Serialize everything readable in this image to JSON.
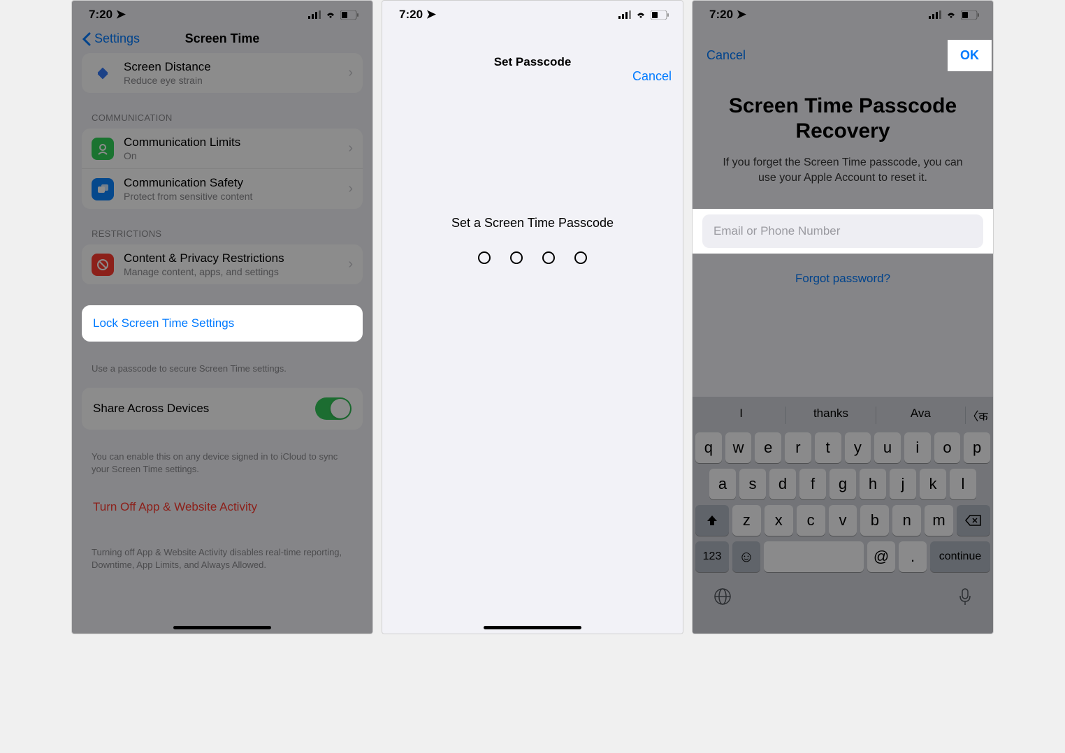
{
  "status": {
    "time": "7:20",
    "location_icon": "▸"
  },
  "phone1": {
    "nav": {
      "back": "Settings",
      "title": "Screen Time"
    },
    "screen_distance": {
      "title": "Screen Distance",
      "sub": "Reduce eye strain"
    },
    "communication_header": "COMMUNICATION",
    "comm_limits": {
      "title": "Communication Limits",
      "sub": "On"
    },
    "comm_safety": {
      "title": "Communication Safety",
      "sub": "Protect from sensitive content"
    },
    "restrictions_header": "RESTRICTIONS",
    "content_privacy": {
      "title": "Content & Privacy Restrictions",
      "sub": "Manage content, apps, and settings"
    },
    "lock_settings": "Lock Screen Time Settings",
    "lock_footer": "Use a passcode to secure Screen Time settings.",
    "share_devices": "Share Across Devices",
    "share_footer": "You can enable this on any device signed in to iCloud to sync your Screen Time settings.",
    "turn_off": "Turn Off App & Website Activity",
    "turn_off_footer": "Turning off App & Website Activity disables real-time reporting, Downtime, App Limits, and Always Allowed."
  },
  "phone2": {
    "title": "Set Passcode",
    "cancel": "Cancel",
    "prompt": "Set a Screen Time Passcode"
  },
  "phone3": {
    "cancel": "Cancel",
    "ok": "OK",
    "title": "Screen Time Passcode Recovery",
    "desc": "If you forget the Screen Time passcode, you can use your Apple Account to reset it.",
    "input_placeholder": "Email or Phone Number",
    "forgot": "Forgot password?",
    "suggestions": [
      "I",
      "thanks",
      "Ava"
    ],
    "keys_row1": [
      "q",
      "w",
      "e",
      "r",
      "t",
      "y",
      "u",
      "i",
      "o",
      "p"
    ],
    "keys_row2": [
      "a",
      "s",
      "d",
      "f",
      "g",
      "h",
      "j",
      "k",
      "l"
    ],
    "keys_row3": [
      "z",
      "x",
      "c",
      "v",
      "b",
      "n",
      "m"
    ],
    "key_123": "123",
    "key_at": "@",
    "key_dot": ".",
    "key_continue": "continue"
  }
}
